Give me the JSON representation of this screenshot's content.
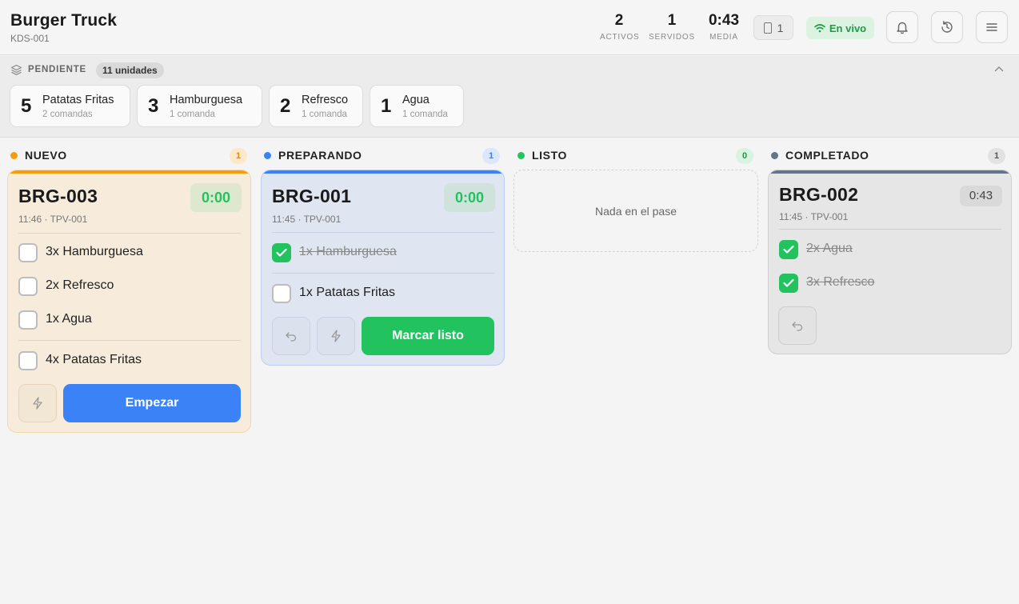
{
  "header": {
    "title": "Burger Truck",
    "subtitle": "KDS-001",
    "stats": [
      {
        "value": "2",
        "label": "ACTIVOS"
      },
      {
        "value": "1",
        "label": "SERVIDOS"
      },
      {
        "value": "0:43",
        "label": "MEDIA"
      }
    ],
    "devices": "1",
    "live_label": "En vivo",
    "icons": [
      "bell-icon",
      "history-icon",
      "menu-icon"
    ]
  },
  "pending": {
    "label": "PENDIENTE",
    "units": "11 unidades",
    "items": [
      {
        "qty": "5",
        "name": "Patatas Fritas",
        "count": "2 comandas"
      },
      {
        "qty": "3",
        "name": "Hamburguesa",
        "count": "1 comanda"
      },
      {
        "qty": "2",
        "name": "Refresco",
        "count": "1 comanda"
      },
      {
        "qty": "1",
        "name": "Agua",
        "count": "1 comanda"
      }
    ]
  },
  "columns": {
    "nuevo": {
      "title": "NUEVO",
      "count": "1",
      "color": "#f59e0b"
    },
    "preparando": {
      "title": "PREPARANDO",
      "count": "1",
      "color": "#3b82f6"
    },
    "listo": {
      "title": "LISTO",
      "count": "0",
      "color": "#22c55e",
      "empty": "Nada en el pase"
    },
    "completado": {
      "title": "COMPLETADO",
      "count": "1",
      "color": "#64748b"
    }
  },
  "orders": {
    "brg003": {
      "code": "BRG-003",
      "meta": "11:46 · TPV-001",
      "timer": "0:00",
      "items": [
        "3x Hamburguesa",
        "2x Refresco",
        "1x Agua",
        "4x Patatas Fritas"
      ],
      "action": "Empezar"
    },
    "brg001": {
      "code": "BRG-001",
      "meta": "11:45 · TPV-001",
      "timer": "0:00",
      "items": [
        "1x Hamburguesa",
        "1x Patatas Fritas"
      ],
      "action": "Marcar listo"
    },
    "brg002": {
      "code": "BRG-002",
      "meta": "11:45 · TPV-001",
      "timer": "0:43",
      "items": [
        "2x Agua",
        "3x Refresco"
      ]
    }
  }
}
